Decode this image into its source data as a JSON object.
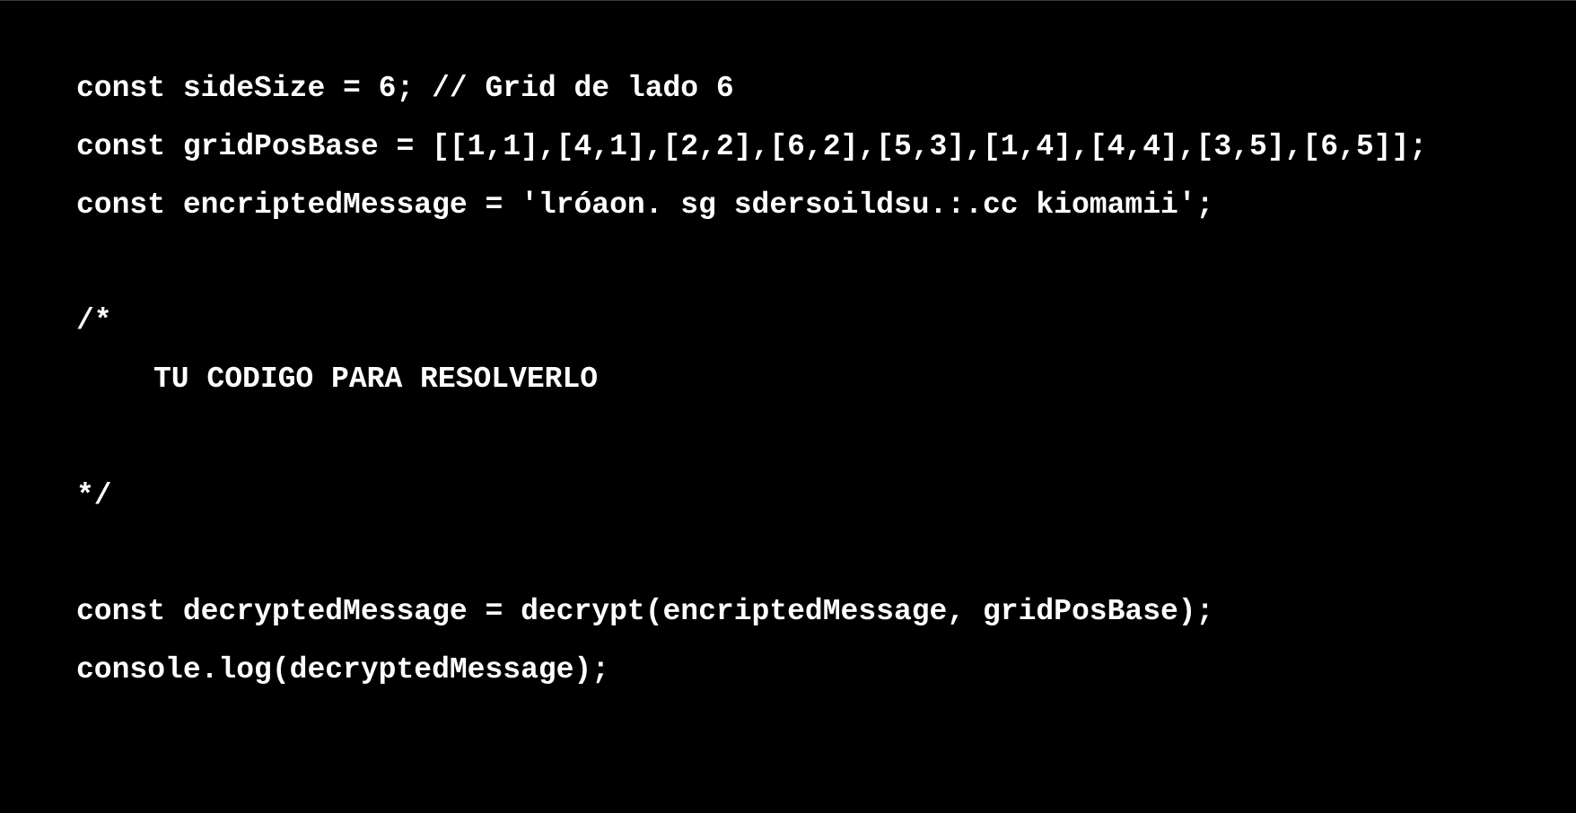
{
  "editor": {
    "background": "#000000",
    "text_color": "#ffffff",
    "lines": [
      "const sideSize = 6; // Grid de lado 6",
      "const gridPosBase = [[1,1],[4,1],[2,2],[6,2],[5,3],[1,4],[4,4],[3,5],[6,5]];",
      "const encriptedMessage = 'lróaon. sg sdersoildsu.:.cc kiomamii';",
      "",
      "/*",
      "TU CODIGO PARA RESOLVERLO",
      "",
      "*/",
      "",
      "const decryptedMessage = decrypt(encriptedMessage, gridPosBase);",
      "console.log(decryptedMessage);"
    ]
  }
}
